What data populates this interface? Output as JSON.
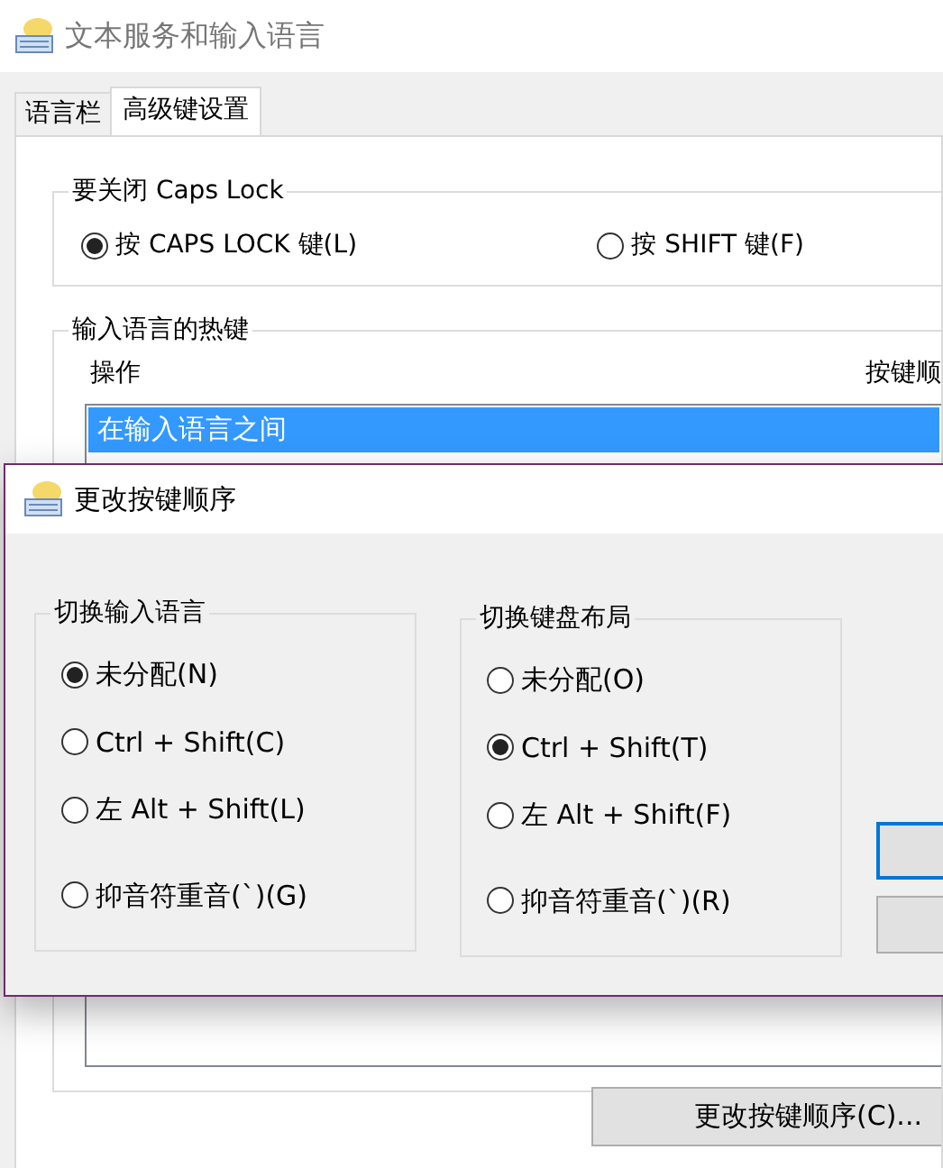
{
  "window": {
    "title": "文本服务和输入语言"
  },
  "tabs": [
    {
      "label": "语言栏",
      "selected": false
    },
    {
      "label": "高级键设置",
      "selected": true
    }
  ],
  "caps_lock_group": {
    "title": "要关闭 Caps Lock",
    "options": [
      {
        "label": "按 CAPS LOCK 键(L)",
        "selected": true
      },
      {
        "label": "按 SHIFT 键(F)",
        "selected": false
      }
    ]
  },
  "hotkeys_group": {
    "title": "输入语言的热键",
    "columns": [
      "操作",
      "按键顺"
    ],
    "rows": [
      {
        "label": "在输入语言之间",
        "selected": true
      }
    ],
    "button": "更改按键顺序(C)..."
  },
  "dialog": {
    "title": "更改按键顺序",
    "groups": [
      {
        "title": "切换输入语言",
        "options": [
          {
            "label": "未分配(N)",
            "selected": true
          },
          {
            "label": "Ctrl + Shift(C)",
            "selected": false
          },
          {
            "label": "左 Alt + Shift(L)",
            "selected": false
          },
          {
            "label": "抑音符重音(`)(G)",
            "selected": false
          }
        ]
      },
      {
        "title": "切换键盘布局",
        "options": [
          {
            "label": "未分配(O)",
            "selected": false
          },
          {
            "label": "Ctrl + Shift(T)",
            "selected": true
          },
          {
            "label": "左 Alt + Shift(F)",
            "selected": false
          },
          {
            "label": "抑音符重音(`)(R)",
            "selected": false
          }
        ]
      }
    ],
    "buttons": [
      {
        "default": true
      },
      {
        "default": false
      }
    ]
  }
}
